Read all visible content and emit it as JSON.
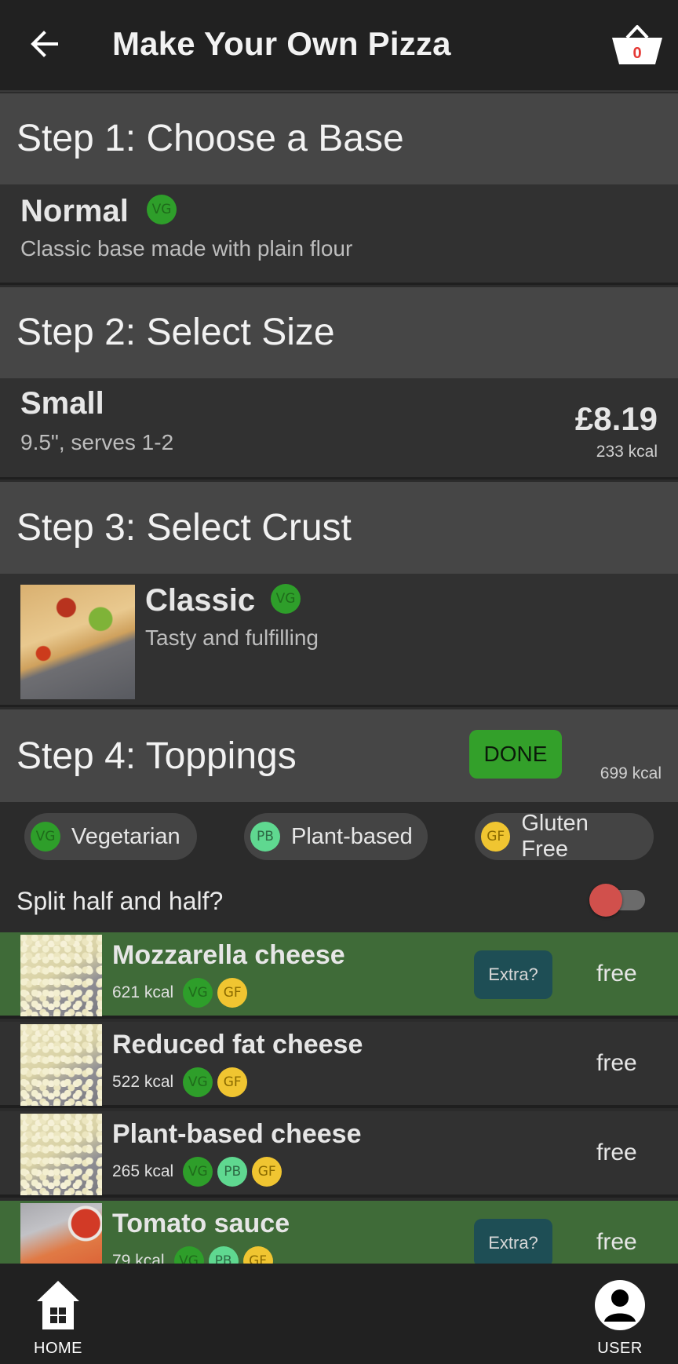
{
  "header": {
    "title": "Make Your Own Pizza",
    "basket_count": "0"
  },
  "step1": {
    "heading": "Step 1: Choose a Base",
    "option": {
      "name": "Normal",
      "badge": "VG",
      "description": "Classic base made with plain flour"
    }
  },
  "step2": {
    "heading": "Step 2: Select Size",
    "option": {
      "name": "Small",
      "description": "9.5\", serves 1-2",
      "price": "£8.19",
      "kcal": "233 kcal"
    }
  },
  "step3": {
    "heading": "Step 3: Select Crust",
    "option": {
      "name": "Classic",
      "badge": "VG",
      "description": "Tasty and fulfilling"
    }
  },
  "step4": {
    "heading": "Step 4: Toppings",
    "done_label": "DONE",
    "kcal": "699 kcal"
  },
  "filters": [
    {
      "badge": "VG",
      "label": "Vegetarian"
    },
    {
      "badge": "PB",
      "label": "Plant-based"
    },
    {
      "badge": "GF",
      "label": "Gluten Free"
    }
  ],
  "split": {
    "label": "Split half and half?",
    "enabled": false
  },
  "toppings": [
    {
      "name": "Mozzarella cheese",
      "kcal": "621 kcal",
      "badges": [
        "VG",
        "GF"
      ],
      "selected": true,
      "extra_label": "Extra?",
      "price": "free"
    },
    {
      "name": "Reduced fat cheese",
      "kcal": "522 kcal",
      "badges": [
        "VG",
        "GF"
      ],
      "selected": false,
      "price": "free"
    },
    {
      "name": "Plant-based cheese",
      "kcal": "265 kcal",
      "badges": [
        "VG",
        "PB",
        "GF"
      ],
      "selected": false,
      "price": "free"
    },
    {
      "name": "Tomato sauce",
      "kcal": "79 kcal",
      "badges": [
        "VG",
        "PB",
        "GF"
      ],
      "selected": true,
      "extra_label": "Extra?",
      "price": "free"
    }
  ],
  "bottom_nav": {
    "home_label": "HOME",
    "user_label": "USER"
  },
  "colors": {
    "selected_row": "#3f6b38",
    "done_button": "#33a02a",
    "vg_badge": "#2e9e2a",
    "pb_badge": "#5fd890",
    "gf_badge": "#f0c531",
    "basket_count": "#e53935",
    "toggle_knob": "#d1504c"
  },
  "icons": [
    "back-arrow-icon",
    "basket-icon",
    "home-icon",
    "user-icon"
  ]
}
